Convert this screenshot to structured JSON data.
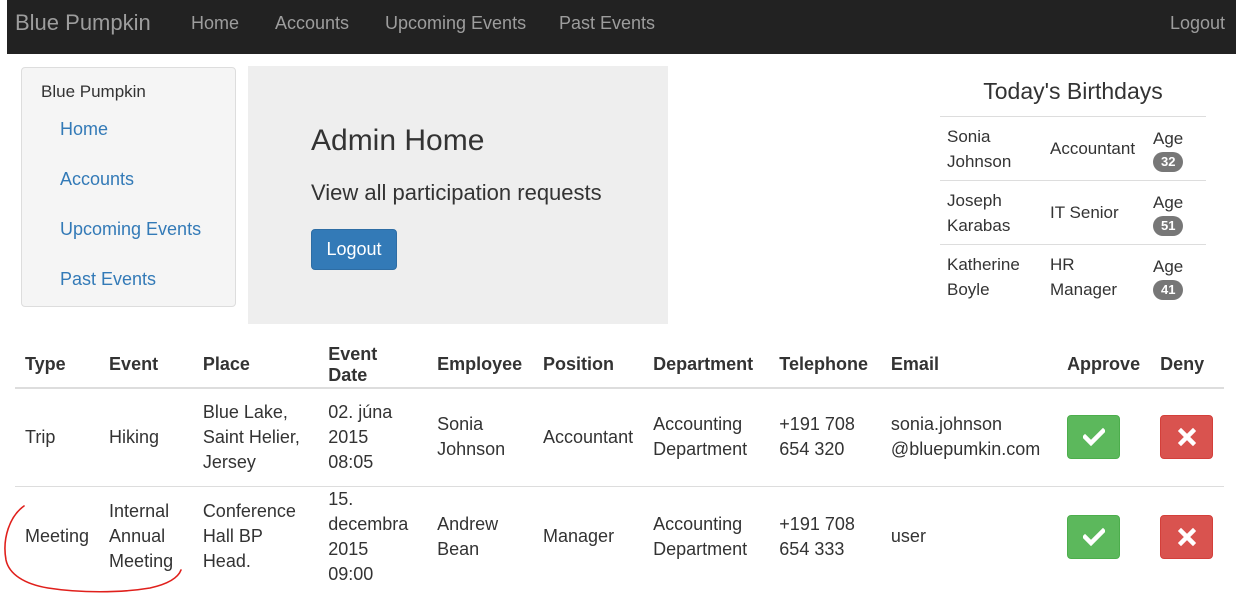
{
  "navbar": {
    "brand": "Blue Pumpkin",
    "links": [
      "Home",
      "Accounts",
      "Upcoming Events",
      "Past Events"
    ],
    "logout": "Logout"
  },
  "sidebar": {
    "title": "Blue Pumpkin",
    "links": [
      "Home",
      "Accounts",
      "Upcoming Events",
      "Past Events"
    ]
  },
  "jumbotron": {
    "title": "Admin Home",
    "subtitle": "View all participation requests",
    "button": "Logout"
  },
  "birthdays": {
    "title": "Today's Birthdays",
    "age_label": "Age",
    "rows": [
      {
        "name": [
          "Sonia",
          "Johnson"
        ],
        "position": [
          "Accountant",
          ""
        ],
        "age": "32"
      },
      {
        "name": [
          "Joseph",
          "Karabas"
        ],
        "position": [
          "IT Senior",
          ""
        ],
        "age": "51"
      },
      {
        "name": [
          "Katherine",
          "Boyle"
        ],
        "position": [
          "HR",
          "Manager"
        ],
        "age": "41"
      }
    ]
  },
  "table": {
    "headers": [
      "Type",
      "Event",
      "Place",
      "Event Date",
      "Employee",
      "Position",
      "Department",
      "Telephone",
      "Email",
      "Approve",
      "Deny"
    ],
    "rows": [
      {
        "type": [
          "Trip"
        ],
        "event": [
          "Hiking"
        ],
        "place": [
          "Blue Lake,",
          "Saint Helier,",
          "Jersey"
        ],
        "date": [
          "02. júna",
          "2015 08:05"
        ],
        "employee": [
          "Sonia",
          "Johnson"
        ],
        "position": [
          "Accountant"
        ],
        "department": [
          "Accounting",
          "Department"
        ],
        "telephone": [
          "+191 708",
          "654 320"
        ],
        "email": [
          "sonia.johnson",
          "@bluepumkin.com"
        ]
      },
      {
        "type": [
          "Meeting"
        ],
        "event": [
          "Internal",
          "Annual",
          "Meeting"
        ],
        "place": [
          "Conference",
          "Hall BP",
          "Head."
        ],
        "date": [
          "15.",
          "decembra",
          "2015 09:00"
        ],
        "employee": [
          "Andrew",
          "Bean"
        ],
        "position": [
          "Manager"
        ],
        "department": [
          "Accounting",
          "Department"
        ],
        "telephone": [
          "+191 708",
          "654 333"
        ],
        "email": [
          "user"
        ]
      }
    ],
    "approve_icon": "check-icon",
    "deny_icon": "x-icon"
  },
  "colors": {
    "navbar_bg": "#222222",
    "link": "#337ab7",
    "primary": "#337ab7",
    "success": "#5cb85c",
    "danger": "#d9534f",
    "annotation": "#e0201c"
  }
}
